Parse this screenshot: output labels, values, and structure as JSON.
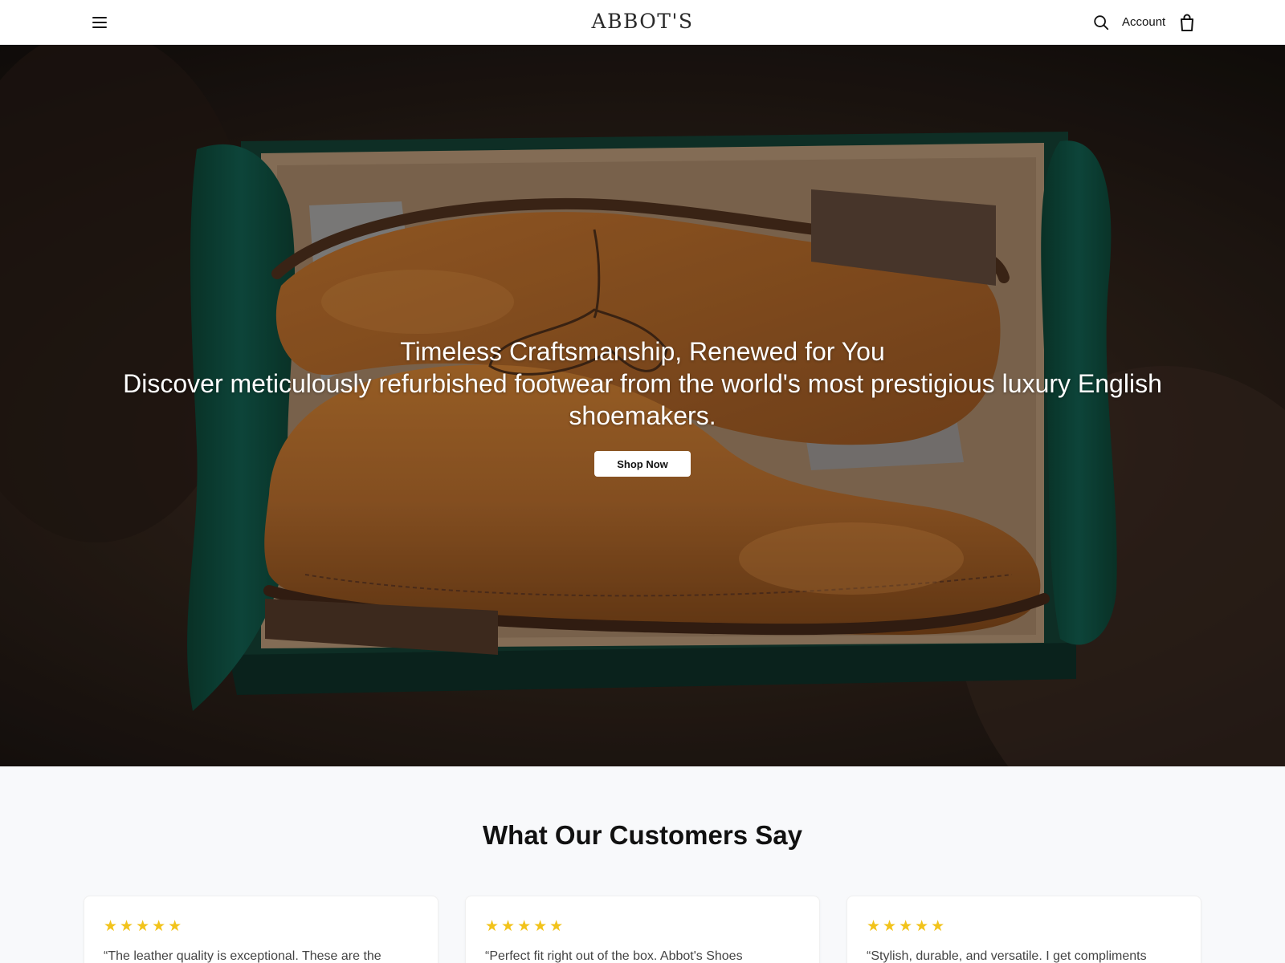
{
  "header": {
    "logo": "ABBOT'S",
    "account_label": "Account",
    "icons": {
      "menu": "hamburger-menu-icon",
      "search": "search-icon",
      "bag": "shopping-bag-icon"
    }
  },
  "hero": {
    "title": "Timeless Craftsmanship, Renewed for You",
    "subtitle": "Discover meticulously refurbished footwear from the world's most prestigious luxury English shoemakers.",
    "cta_label": "Shop Now"
  },
  "testimonials": {
    "heading": "What Our Customers Say",
    "reviews": [
      {
        "stars": "★★★★★",
        "rating": 5,
        "quote": "“The leather quality is exceptional. These are the"
      },
      {
        "stars": "★★★★★",
        "rating": 5,
        "quote": "“Perfect fit right out of the box. Abbot's Shoes"
      },
      {
        "stars": "★★★★★",
        "rating": 5,
        "quote": "“Stylish, durable, and versatile. I get compliments"
      }
    ]
  },
  "colors": {
    "star": "#f2c31b",
    "box_green": "#0f4a3a",
    "leather_tan": "#a9652a"
  }
}
